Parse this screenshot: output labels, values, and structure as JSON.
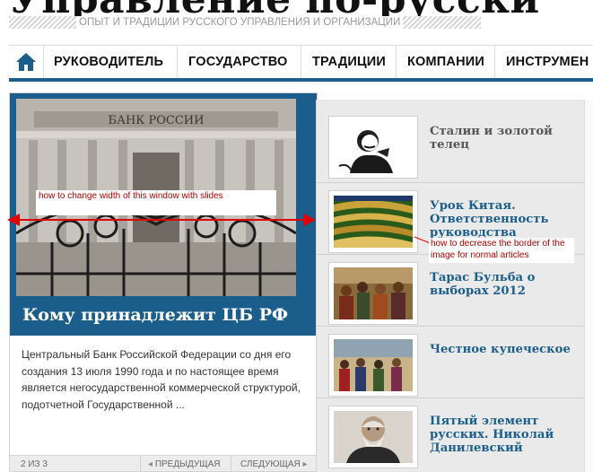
{
  "header": {
    "site_title": "Управление по-русски",
    "tagline": "ОПЫТ И ТРАДИЦИИ РУССКОГО УПРАВЛЕНИЯ И ОРГАНИЗАЦИИ"
  },
  "nav": {
    "home_icon": "home-icon",
    "items": [
      {
        "label": "РУКОВОДИТЕЛЬ"
      },
      {
        "label": "ГОСУДАРСТВО"
      },
      {
        "label": "ТРАДИЦИИ"
      },
      {
        "label": "КОМПАНИИ"
      },
      {
        "label": "ИНСТРУМЕН"
      }
    ]
  },
  "featured": {
    "building_sign": "БАНК РОССИИ",
    "title": "Кому принадлежит ЦБ РФ",
    "excerpt": "Центральный Банк Российской Федерации со дня его создания 13 июля 1990 года и по настоящее время является негосударственной коммерческой структурой, подотчетной Государственной ...",
    "pager": {
      "count": "2 ИЗ 3",
      "prev": "ПРЕДЫДУЩАЯ",
      "next": "СЛЕДУЮЩАЯ"
    }
  },
  "articles": [
    {
      "title": "Сталин и золотой телец",
      "color": "#555555"
    },
    {
      "title": "Урок Китая. Ответственность руководства",
      "color": "#1b5e8a"
    },
    {
      "title": "Тарас Бульба о выборах 2012",
      "color": "#1b5e8a"
    },
    {
      "title": "Честное купеческое",
      "color": "#1b5e8a"
    },
    {
      "title": "Пятый элемент русских. Николай Данилевский",
      "color": "#1b5e8a"
    }
  ],
  "annotations": {
    "slider_width": "how to change width of this window with slides",
    "image_border": "how to decrease the border of the image for normal articles"
  },
  "colors": {
    "brand_blue": "#1b5e8a",
    "annotation_red": "#e00000"
  }
}
